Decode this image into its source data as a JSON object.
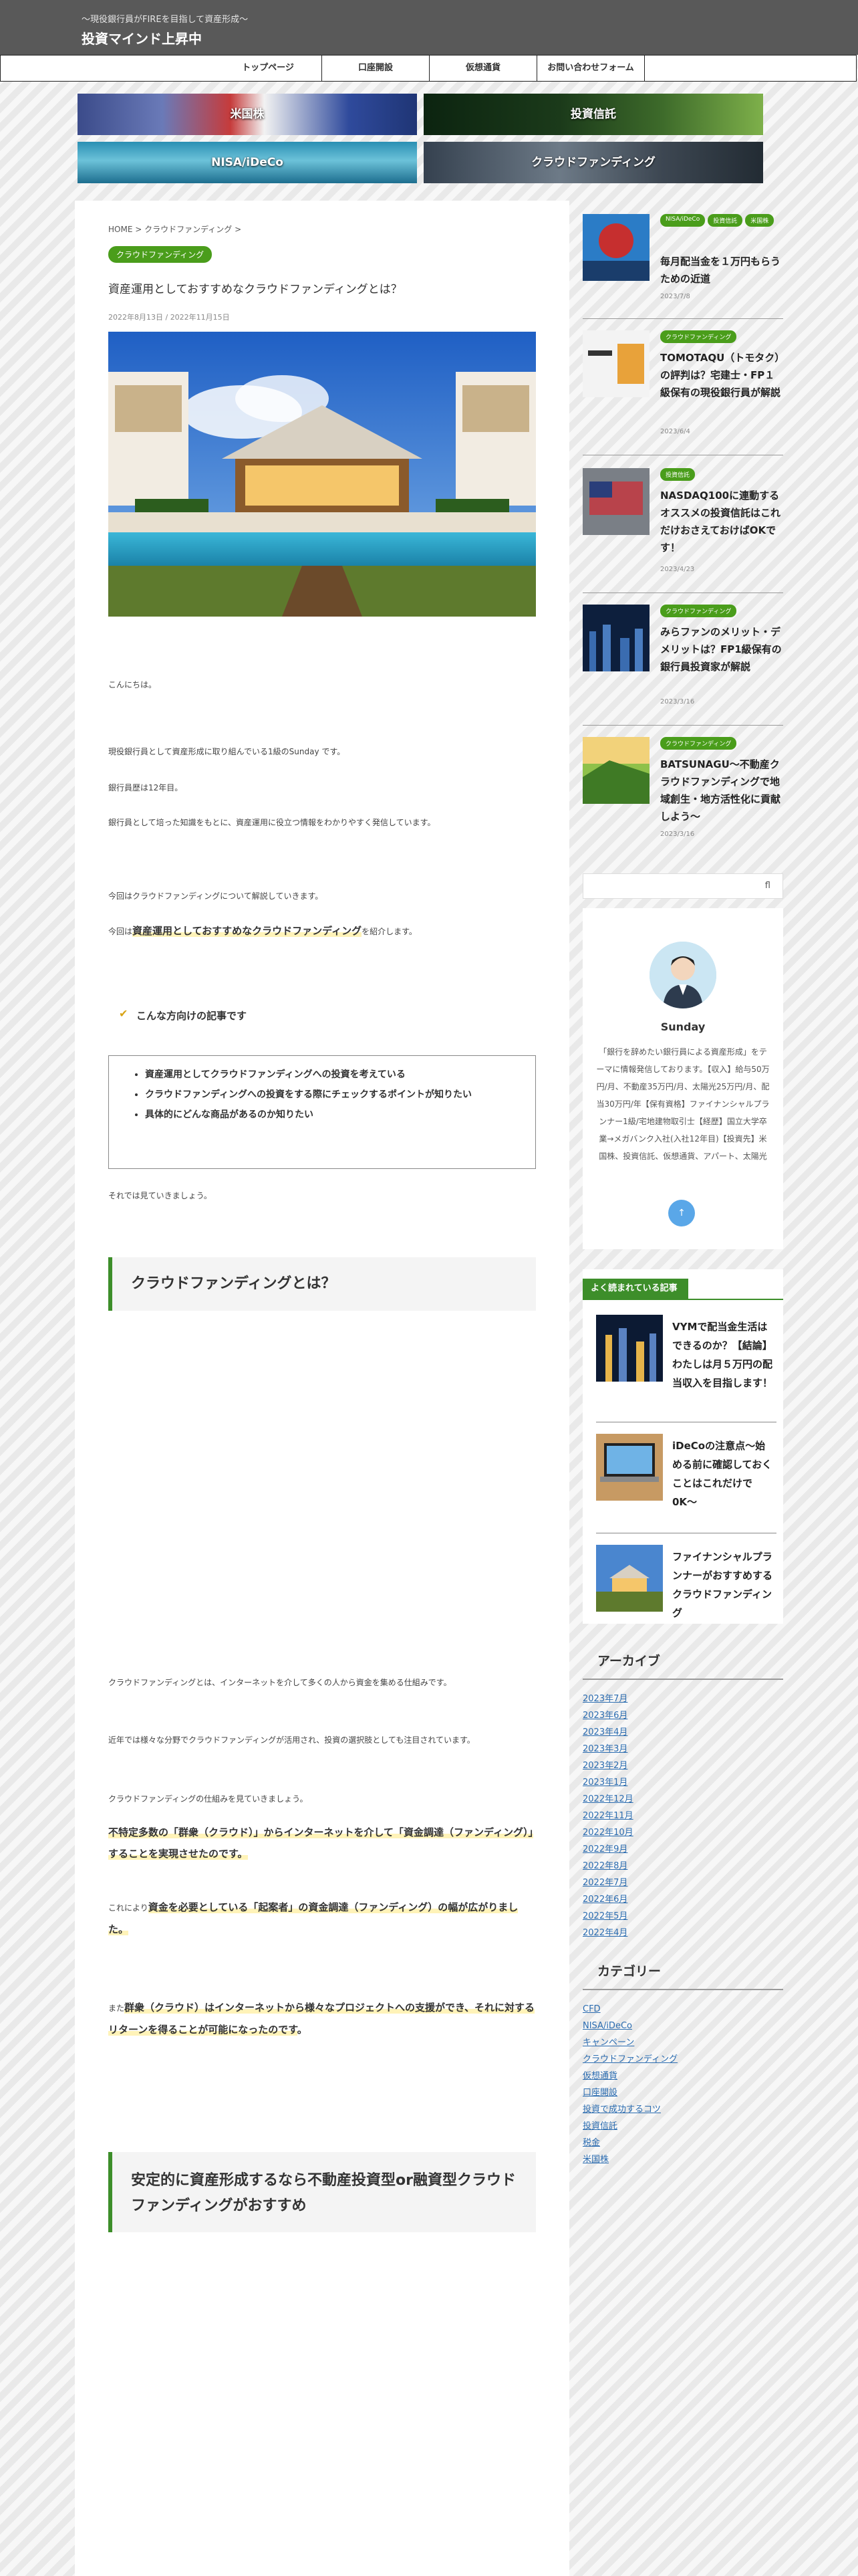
{
  "header": {
    "tagline": "〜現役銀行員がFIREを目指して資産形成〜",
    "site_title": "投資マインド上昇中"
  },
  "nav": [
    "トップページ",
    "口座開設",
    "仮想通貨",
    "お問い合わせフォーム"
  ],
  "banners": {
    "us_stocks": "米国株",
    "investment_trust": "投資信託",
    "nisa": "NISA/iDeCo",
    "crowdfunding": "クラウドファンディング"
  },
  "article": {
    "breadcrumb": "HOME > クラウドファンディング >",
    "category": "クラウドファンディング",
    "title": "資産運用としておすすめなクラウドファンディングとは？",
    "dates": "2022年8月13日 / 2022年11月15日",
    "paragraphs": {
      "p1": "こんにちは。",
      "p2": "現役銀行員として資産形成に取り組んでいる1級のSunday です。",
      "p3": "銀行員歴は12年目。",
      "p4": "銀行員として培った知識をもとに、資産運用に役立つ情報をわかりやすく発信しています。",
      "p5": "今回はクラウドファンディングについて解説していきます。",
      "p6_pre": "今回は",
      "p6_hl": "資産運用としておすすめなクラウドファンディング",
      "p6_post": "を紹介します。",
      "p7": "それでは見ていきましょう。",
      "p8": "クラウドファンディングとは、インターネットを介して多くの人から資金を集める仕組みです。",
      "p9": "近年では様々な分野でクラウドファンディングが活用され、投資の選択肢としても注目されています。",
      "p10": "クラウドファンディングの仕組みを見ていきましょう。",
      "b1": "不特定多数の「群衆（クラウド）」からインターネットを介して「資金調達（ファンディング）」することを実現させたのです。",
      "b2_pre": "これにより",
      "b2_hl": "資金を必要としている「起案者」の資金調達（ファンディング）の幅が広がりました。",
      "b3_pre": "また",
      "b3_hl": "群衆（クラウド）はインターネットから様々なプロジェクトへの支援ができ、それに対するリターンを得ることが可能になったのです",
      "b3_post": "。"
    },
    "checklist_heading": "こんな方向けの記事です",
    "checklist": [
      "資産運用としてクラウドファンディングへの投資を考えている",
      "クラウドファンディングへの投資をする際にチェックするポイントが知りたい",
      "具体的にどんな商品があるのか知りたい"
    ],
    "h2_1": "クラウドファンディングとは？",
    "h2_2": "安定的に資産形成するなら不動産投資型or融資型クラウドファンディングがおすすめ"
  },
  "sidebar": {
    "posts": [
      {
        "badges": [
          "NISA/iDeCo",
          "投資信託",
          "米国株"
        ],
        "title": "毎月配当金を１万円もらうための近道",
        "date": "2023/7/8"
      },
      {
        "badges": [
          "クラウドファンディング"
        ],
        "title": "TOMOTAQU（トモタク）の評判は？宅建士・FP１級保有の現役銀行員が解説",
        "date": "2023/6/4"
      },
      {
        "badges": [
          "投資信託"
        ],
        "title": "NASDAQ100に連動するオススメの投資信託はこれだけおさえておけばOKです！",
        "date": "2023/4/23"
      },
      {
        "badges": [
          "クラウドファンディング"
        ],
        "title": "みらファンのメリット・デメリットは？FP1級保有の銀行員投資家が解説",
        "date": "2023/3/16"
      },
      {
        "badges": [
          "クラウドファンディング"
        ],
        "title": "BATSUNAGU〜不動産クラウドファンディングで地域創生・地方活性化に貢献しよう〜",
        "date": "2023/3/16"
      }
    ],
    "search_icon": "fl",
    "profile": {
      "name": "Sunday",
      "description": "「銀行を辞めたい銀行員による資産形成」をテーマに情報発信しております。【収入】給与50万円/月、不動産35万円/月、太陽光25万円/月、配当30万円/年【保有資格】ファイナンシャルプランナー1級/宅地建物取引士【経歴】国立大学卒業→メガバンク入社(入社12年目)【投資先】米国株、投資信託、仮想通貨、アパート、太陽光",
      "arrow": "↑"
    },
    "popular_heading": "よく読まれている記事",
    "popular": [
      {
        "title": "VYMで配当金生活はできるのか？【結論】わたしは月５万円の配当収入を目指します！"
      },
      {
        "title": "iDeCoの注意点〜始める前に確認しておくことはこれだけで0K〜"
      },
      {
        "title": "ファイナンシャルプランナーがおすすめするクラウドファンディング"
      }
    ],
    "archive_heading": "アーカイブ",
    "archives": [
      "2023年7月",
      "2023年6月",
      "2023年4月",
      "2023年3月",
      "2023年2月",
      "2023年1月",
      "2022年12月",
      "2022年11月",
      "2022年10月",
      "2022年9月",
      "2022年8月",
      "2022年7月",
      "2022年6月",
      "2022年5月",
      "2022年4月"
    ],
    "category_heading": "カテゴリー",
    "categories": [
      "CFD",
      "NISA/iDeCo",
      "キャンペーン",
      "クラウドファンディング",
      "仮想通貨",
      "口座開設",
      "投資で成功するコツ",
      "投資信託",
      "税金",
      "米国株"
    ]
  }
}
